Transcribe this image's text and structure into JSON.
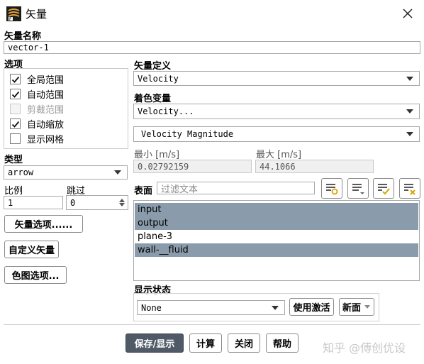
{
  "window": {
    "title": "矢量",
    "icon": "fluent-app-icon",
    "close": "close-icon"
  },
  "vector_name": {
    "label": "矢量名称",
    "value": "vector-1"
  },
  "options": {
    "label": "选项",
    "items": [
      {
        "label": "全局范围",
        "checked": true,
        "enabled": true
      },
      {
        "label": "自动范围",
        "checked": true,
        "enabled": true
      },
      {
        "label": "剪裁范围",
        "checked": false,
        "enabled": false
      },
      {
        "label": "自动缩放",
        "checked": true,
        "enabled": true
      },
      {
        "label": "显示网格",
        "checked": false,
        "enabled": true
      }
    ]
  },
  "type": {
    "label": "类型",
    "value": "arrow"
  },
  "scale": {
    "label": "比例",
    "value": "1"
  },
  "skip": {
    "label": "跳过",
    "value": "0"
  },
  "buttons": {
    "vector_options": "矢量选项......",
    "custom_vector": "自定义矢量",
    "colormap_options": "色图选项...",
    "use_active": "使用激活",
    "new_surface": "新面",
    "save_display": "保存/显示",
    "compute": "计算",
    "close": "关闭",
    "help": "帮助"
  },
  "vector_def": {
    "label": "矢量定义",
    "value": "Velocity"
  },
  "color_by": {
    "label": "着色变量",
    "value": "Velocity...",
    "sub_value": "Velocity Magnitude"
  },
  "range": {
    "min_label": "最小 [m/s]",
    "min_value": "0.02792159",
    "max_label": "最大 [m/s]",
    "max_value": "44.1066"
  },
  "surfaces": {
    "label": "表面",
    "filter_placeholder": "过滤文本",
    "items": [
      {
        "name": "input",
        "selected": true
      },
      {
        "name": "output",
        "selected": true
      },
      {
        "name": "plane-3",
        "selected": false
      },
      {
        "name": "wall-__fluid",
        "selected": true
      }
    ]
  },
  "display_state": {
    "label": "显示状态",
    "value": "None"
  },
  "watermark": "知乎 @傅创优设",
  "colors": {
    "selection": "#8a9cab",
    "primary_button": "#4f5a66",
    "check_icon": "#d9a300",
    "clear_icon": "#d9a300"
  }
}
